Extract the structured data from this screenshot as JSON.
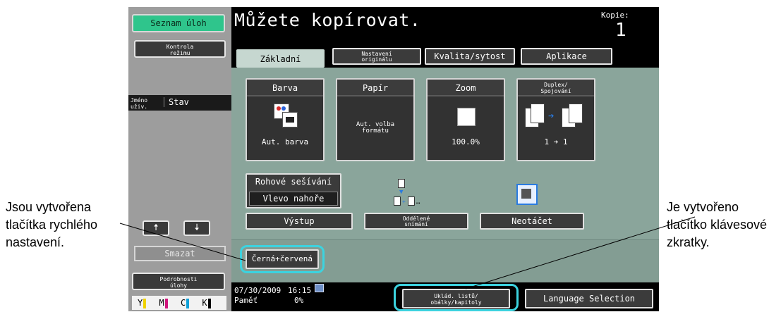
{
  "callouts": {
    "left": [
      "Jsou vytvořena",
      "tlačítka rychlého",
      "nastavení."
    ],
    "right": [
      "Je vytvořeno",
      "tlačítko klávesové",
      "zkratky."
    ]
  },
  "sidebar": {
    "job_list_button": "Seznam úloh",
    "check_mode_button": [
      "Kontrola",
      "režimu"
    ],
    "col_user": [
      "Jméno",
      "uživ."
    ],
    "col_status": "Stav",
    "delete_button": "Smazat",
    "job_details_button": [
      "Podrobnosti",
      "úlohy"
    ],
    "toner": [
      "Y",
      "M",
      "C",
      "K"
    ]
  },
  "header": {
    "message": "Můžete kopírovat.",
    "copies_label": "Kopie:",
    "copies_value": "1"
  },
  "tabs": [
    {
      "label": "Základní"
    },
    {
      "label": [
        "Nastavení",
        "originálu"
      ]
    },
    {
      "label": "Kvalita/sytost"
    },
    {
      "label": "Aplikace"
    }
  ],
  "cards": {
    "color": {
      "title": "Barva",
      "value": "Aut. barva"
    },
    "paper": {
      "title": "Papír",
      "value": [
        "Aut. volba",
        "formátu"
      ]
    },
    "zoom": {
      "title": "Zoom",
      "value": "100.0%"
    },
    "duplex": {
      "title": [
        "Duplex/",
        "Spojování"
      ],
      "value": "1 ➔ 1"
    }
  },
  "finishing": {
    "corner_staple": "Rohové sešívání",
    "corner_staple_value": "Vlevo nahoře",
    "output_button": "Výstup",
    "separate_scan_button": [
      "Oddělené",
      "snímání"
    ],
    "no_rotate_button": "Neotáčet"
  },
  "quick_setting": {
    "label": "Černá+červená"
  },
  "status": {
    "date": "07/30/2009",
    "time": "16:15",
    "memory_label": "Paměť",
    "memory_value": "0%",
    "shortcut_button": [
      "Uklád. listů/",
      "obálky/kapitoly"
    ],
    "language_button": "Language Selection"
  },
  "colors": {
    "callout_ring": "#3cd3df",
    "green_button": "#2fc58c",
    "panel": "#8aa59b",
    "sidebar": "#9d9d9d"
  }
}
